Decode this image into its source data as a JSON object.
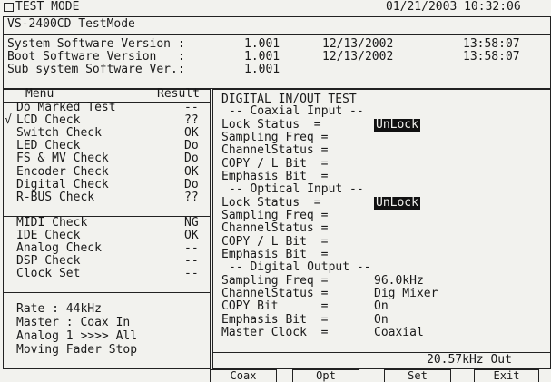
{
  "title_bar": {
    "title": "TEST MODE",
    "datetime": "01/21/2003 10:32:06"
  },
  "device": "VS-2400CD TestMode",
  "versions": [
    {
      "label": "System Software Version :",
      "version": "1.001",
      "date": "12/13/2002",
      "time": "13:58:07"
    },
    {
      "label": "Boot Software Version   :",
      "version": "1.001",
      "date": "12/13/2002",
      "time": "13:58:07"
    },
    {
      "label": "Sub system Software Ver.:",
      "version": "1.001",
      "date": "",
      "time": ""
    }
  ],
  "menu": {
    "header_menu": "Menu",
    "header_result": "Result",
    "items": [
      {
        "mark": "",
        "label": "Do Marked Test",
        "result": "--"
      },
      {
        "mark": "√",
        "label": "LCD Check",
        "result": "??"
      },
      {
        "mark": "",
        "label": "Switch Check",
        "result": "OK"
      },
      {
        "mark": "",
        "label": "LED Check",
        "result": "Do"
      },
      {
        "mark": "",
        "label": "FS & MV Check",
        "result": "Do"
      },
      {
        "mark": "",
        "label": "Encoder Check",
        "result": "OK"
      },
      {
        "mark": "",
        "label": "Digital Check",
        "result": "Do"
      },
      {
        "mark": "",
        "label": "R-BUS Check",
        "result": "??"
      },
      {
        "mark": "",
        "label": "MIDI Check",
        "result": "NG"
      },
      {
        "mark": "",
        "label": "IDE Check",
        "result": "OK"
      },
      {
        "mark": "",
        "label": "Analog Check",
        "result": "--"
      },
      {
        "mark": "",
        "label": "DSP Check",
        "result": "--"
      },
      {
        "mark": "",
        "label": "Clock Set",
        "result": "--"
      }
    ]
  },
  "status": {
    "rate": "Rate : 44kHz",
    "master": "Master : Coax In",
    "analog": "Analog 1 >>>> All",
    "fader": "Moving Fader Stop"
  },
  "digital_test": {
    "title": "DIGITAL IN/OUT TEST",
    "coaxial_header": "-- Coaxial Input --",
    "coaxial": [
      {
        "label": "Lock Status  =",
        "value": "UnLock",
        "highlight": true
      },
      {
        "label": "Sampling Freq =",
        "value": "",
        "highlight": false
      },
      {
        "label": "ChannelStatus =",
        "value": "",
        "highlight": false
      },
      {
        "label": "COPY / L Bit  =",
        "value": "",
        "highlight": false
      },
      {
        "label": "Emphasis Bit  =",
        "value": "",
        "highlight": false
      }
    ],
    "optical_header": "-- Optical Input --",
    "optical": [
      {
        "label": "Lock Status  =",
        "value": "UnLock",
        "highlight": true
      },
      {
        "label": "Sampling Freq =",
        "value": "",
        "highlight": false
      },
      {
        "label": "ChannelStatus =",
        "value": "",
        "highlight": false
      },
      {
        "label": "COPY / L Bit  =",
        "value": "",
        "highlight": false
      },
      {
        "label": "Emphasis Bit  =",
        "value": "",
        "highlight": false
      }
    ],
    "output_header": "-- Digital Output --",
    "output": [
      {
        "label": "Sampling Freq =",
        "value": "96.0kHz"
      },
      {
        "label": "ChannelStatus =",
        "value": "Dig Mixer"
      },
      {
        "label": "COPY Bit      =",
        "value": "On"
      },
      {
        "label": "Emphasis Bit  =",
        "value": "On"
      },
      {
        "label": "Master Clock  =",
        "value": "Coaxial"
      }
    ],
    "status_line": "20.57kHz Out"
  },
  "softkeys": [
    "Coax",
    "Opt",
    "Set",
    "Exit"
  ]
}
